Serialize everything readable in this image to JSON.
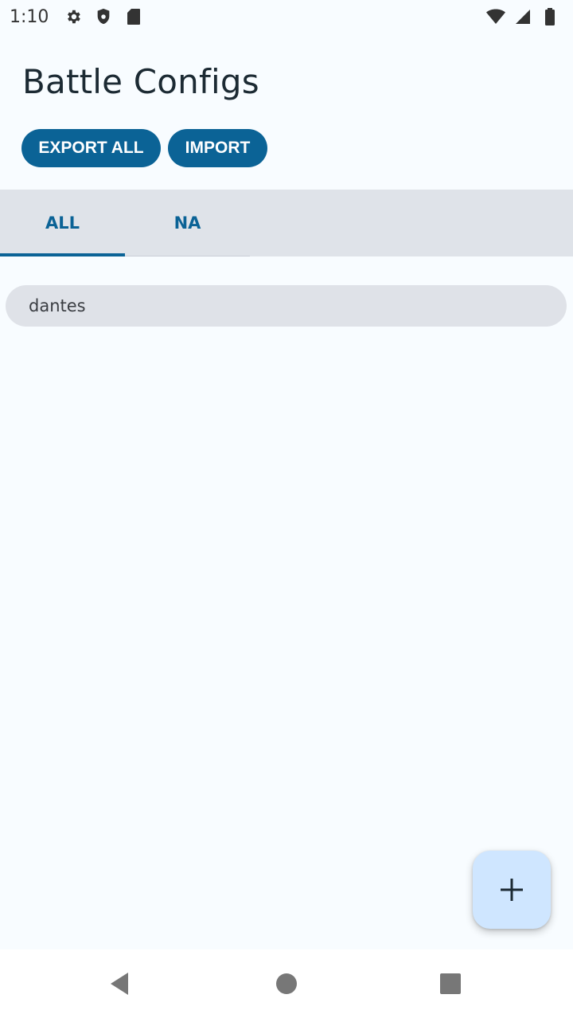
{
  "status_bar": {
    "time": "1:10",
    "left_icons": [
      "gear-icon",
      "shield-icon",
      "sd-card-icon"
    ],
    "right_icons": [
      "wifi-icon",
      "signal-icon",
      "battery-icon"
    ]
  },
  "header": {
    "title": "Battle Configs"
  },
  "actions": {
    "export_label": "EXPORT ALL",
    "import_label": "IMPORT"
  },
  "tabs": [
    {
      "label": "ALL",
      "selected": true
    },
    {
      "label": "NA",
      "selected": false
    }
  ],
  "list": {
    "items": [
      {
        "label": "dantes"
      }
    ]
  },
  "fab": {
    "icon": "plus-icon"
  },
  "nav_bar": {
    "icons": [
      "back-icon",
      "home-icon",
      "recents-icon"
    ]
  },
  "colors": {
    "accent": "#0b6396",
    "background": "#f8fcff",
    "tab_bar": "#dfe3e9",
    "list_item": "#dfe2e8",
    "fab": "#cfe6ff"
  }
}
